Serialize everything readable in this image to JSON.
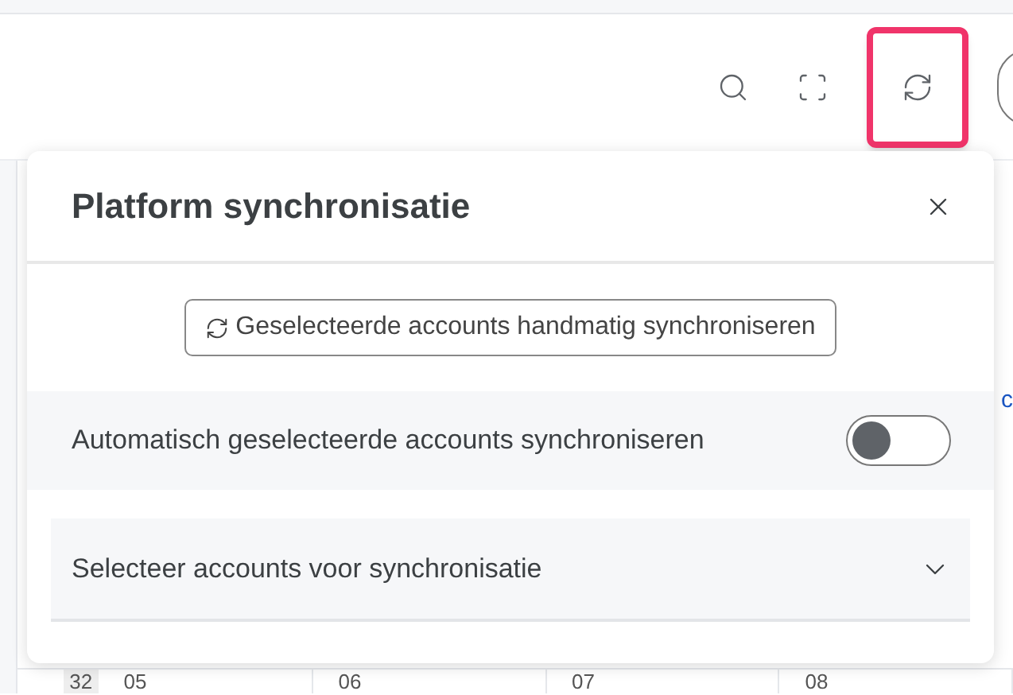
{
  "toolbar": {
    "buttons": [
      {
        "kind": "search",
        "selected": false
      },
      {
        "kind": "fullscreen",
        "selected": false
      },
      {
        "kind": "sync",
        "selected": true
      }
    ]
  },
  "popover": {
    "title": "Platform synchronisatie",
    "sync_button": "Geselecteerde accounts handmatig synchroniseren",
    "auto_sync": {
      "label": "Automatisch geselecteerde accounts synchroniseren",
      "on": false
    },
    "accounts_section": {
      "label": "Selecteer accounts voor synchronisatie",
      "expanded": false
    }
  },
  "calendar": {
    "week": "32",
    "days": [
      "05",
      "06",
      "07",
      "08"
    ],
    "column_5_fragment": "c"
  }
}
